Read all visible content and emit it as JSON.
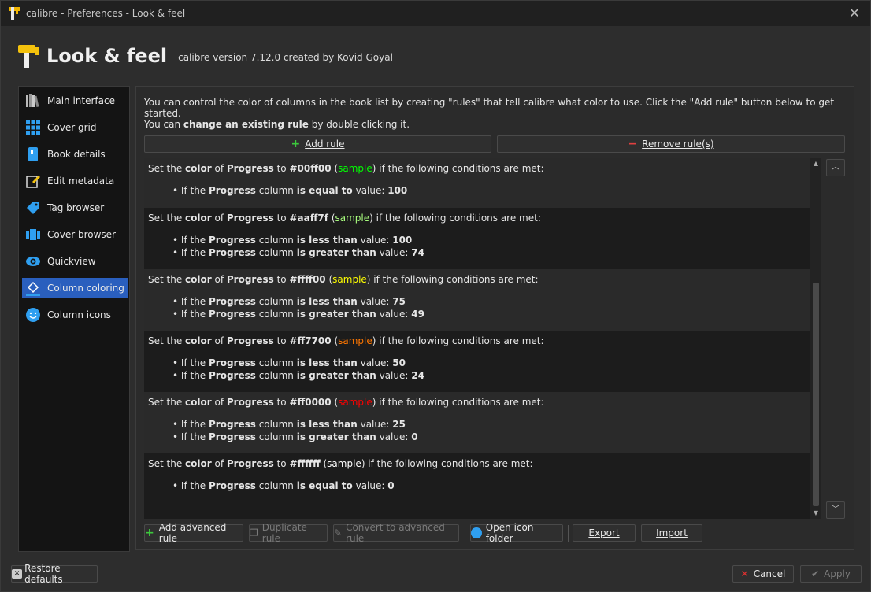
{
  "window": {
    "title": "calibre - Preferences - Look & feel",
    "close": "✕"
  },
  "header": {
    "title": "Look & feel",
    "subtitle": "calibre version 7.12.0 created by Kovid Goyal"
  },
  "sidebar": {
    "items": [
      {
        "label": "Main interface",
        "icon": "books-icon"
      },
      {
        "label": "Cover grid",
        "icon": "grid-icon"
      },
      {
        "label": "Book details",
        "icon": "book-details-icon"
      },
      {
        "label": "Edit metadata",
        "icon": "edit-icon"
      },
      {
        "label": "Tag browser",
        "icon": "tag-icon"
      },
      {
        "label": "Cover browser",
        "icon": "cover-browser-icon"
      },
      {
        "label": "Quickview",
        "icon": "eye-icon"
      },
      {
        "label": "Column coloring",
        "icon": "paint-bucket-icon",
        "active": true
      },
      {
        "label": "Column icons",
        "icon": "smiley-icon"
      }
    ]
  },
  "intro": {
    "line1": "You can control the color of columns in the book list by creating \"rules\" that tell calibre what color to use. Click the \"Add rule\" button below to get started.",
    "line2_pre": "You can ",
    "line2_bold": "change an existing rule",
    "line2_post": " by double clicking it."
  },
  "buttons": {
    "add_rule": "Add rule",
    "remove_rule": "Remove rule(s)",
    "add_advanced": "Add advanced rule",
    "duplicate": "Duplicate rule",
    "convert": "Convert to advanced rule",
    "open_icon_folder": "Open icon folder",
    "export": "Export",
    "import": "Import",
    "restore_defaults": "Restore defaults",
    "cancel": "Cancel",
    "apply": "Apply"
  },
  "rule_text": {
    "set_the": "Set the ",
    "color": "color",
    "of": " of ",
    "column": "Progress",
    "to": " to ",
    "sample": "sample",
    "conditions": " if the following conditions are met:",
    "if_the": "If the ",
    "column_word": " column ",
    "value": " value: "
  },
  "rules": [
    {
      "color": "#00ff00",
      "sample_color": "#00ff00",
      "conds": [
        {
          "op": "is equal to",
          "val": "100"
        }
      ]
    },
    {
      "color": "#aaff7f",
      "sample_color": "#aaff7f",
      "conds": [
        {
          "op": "is less than",
          "val": "100"
        },
        {
          "op": "is greater than",
          "val": "74"
        }
      ]
    },
    {
      "color": "#ffff00",
      "sample_color": "#ffff00",
      "conds": [
        {
          "op": "is less than",
          "val": "75"
        },
        {
          "op": "is greater than",
          "val": "49"
        }
      ]
    },
    {
      "color": "#ff7700",
      "sample_color": "#ff7700",
      "conds": [
        {
          "op": "is less than",
          "val": "50"
        },
        {
          "op": "is greater than",
          "val": "24"
        }
      ]
    },
    {
      "color": "#ff0000",
      "sample_color": "#ff0000",
      "conds": [
        {
          "op": "is less than",
          "val": "25"
        },
        {
          "op": "is greater than",
          "val": "0"
        }
      ]
    },
    {
      "color": "#ffffff",
      "sample_color": "#ffffff",
      "conds": [
        {
          "op": "is equal to",
          "val": "0"
        }
      ]
    }
  ],
  "colors": {
    "accent": "#2a5fbe",
    "add": "#3cc83c",
    "remove": "#e04040",
    "cancel_x": "#e03030"
  }
}
